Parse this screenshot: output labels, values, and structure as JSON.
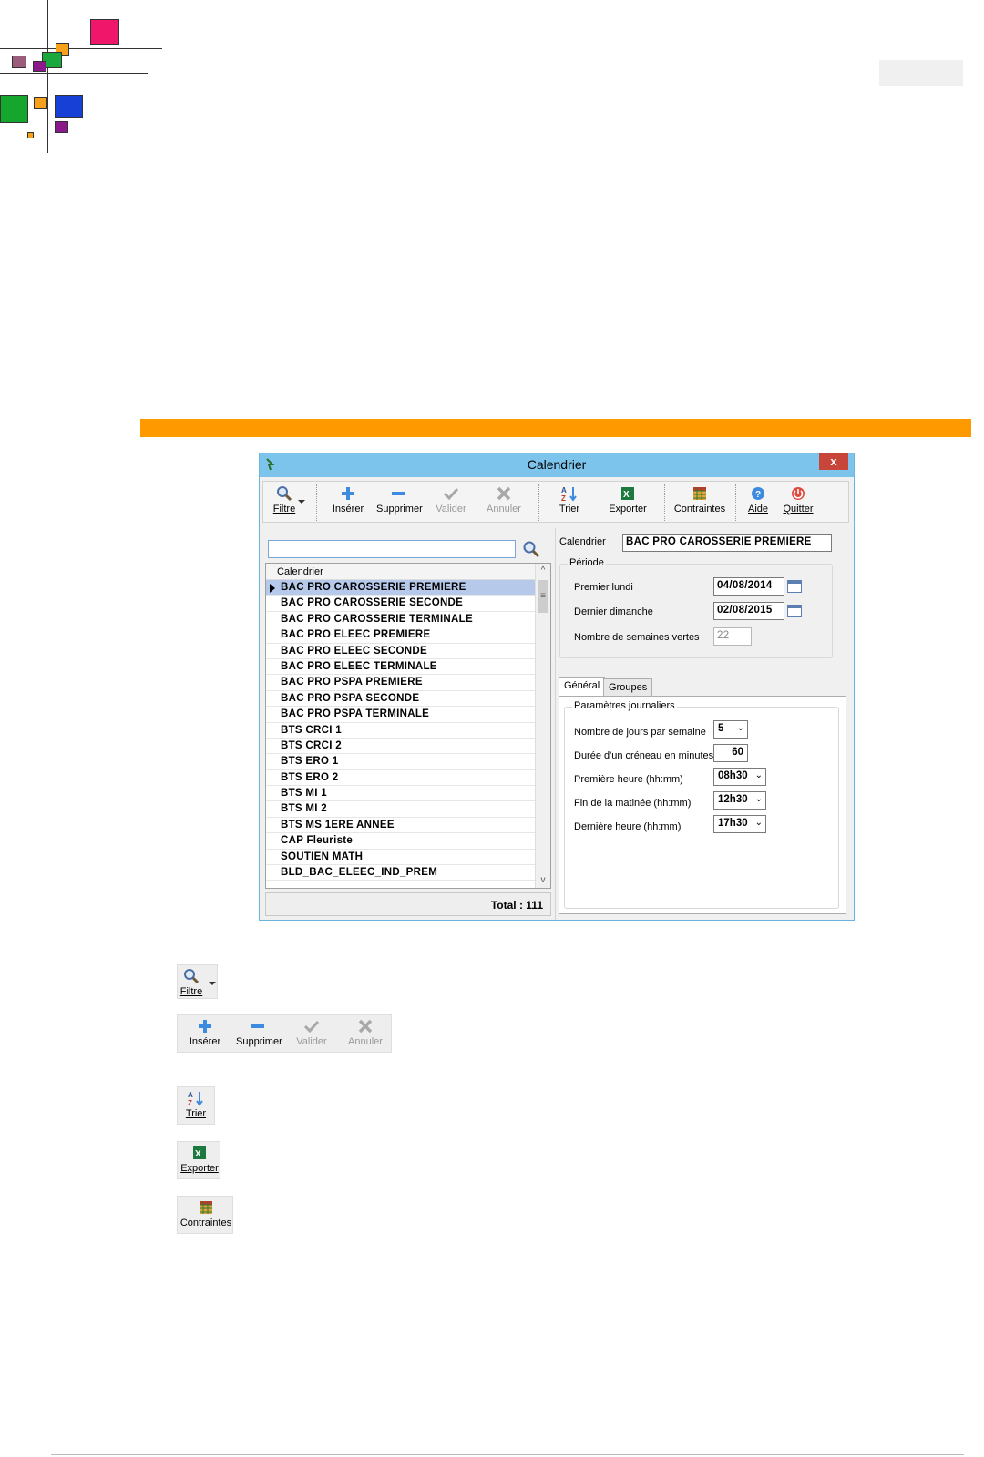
{
  "window": {
    "title": "Calendrier",
    "close_symbol": "x"
  },
  "toolbar": {
    "filtre": "Filtre",
    "inserer": "Insérer",
    "supprimer": "Supprimer",
    "valider": "Valider",
    "annuler": "Annuler",
    "trier": "Trier",
    "exporter": "Exporter",
    "contraintes": "Contraintes",
    "aide": "Aide",
    "quitter": "Quitter"
  },
  "list": {
    "search_value": "",
    "column_header": "Calendrier",
    "rows": [
      "BAC PRO CAROSSERIE PREMIERE",
      "BAC PRO CAROSSERIE SECONDE",
      "BAC PRO CAROSSERIE TERMINALE",
      "BAC PRO ELEEC PREMIERE",
      "BAC PRO ELEEC SECONDE",
      "BAC PRO ELEEC TERMINALE",
      "BAC PRO PSPA PREMIERE",
      "BAC PRO PSPA SECONDE",
      "BAC PRO PSPA TERMINALE",
      "BTS CRCI 1",
      "BTS CRCI 2",
      "BTS ERO 1",
      "BTS ERO 2",
      "BTS MI 1",
      "BTS MI 2",
      "BTS MS 1ERE ANNEE",
      "CAP Fleuriste",
      "SOUTIEN MATH",
      "BLD_BAC_ELEEC_IND_PREM"
    ],
    "total": "Total : 111",
    "scroll_up": "^",
    "scroll_down": "v",
    "thumb_glyph": "≡"
  },
  "detail": {
    "calendrier_label": "Calendrier",
    "calendrier_value": "BAC PRO CAROSSERIE PREMIERE",
    "periode_title": "Période",
    "premier_lundi_label": "Premier lundi",
    "premier_lundi_value": "04/08/2014",
    "dernier_dimanche_label": "Dernier dimanche",
    "dernier_dimanche_value": "02/08/2015",
    "semaines_label": "Nombre de semaines vertes",
    "semaines_value": "22",
    "tab_general": "Général",
    "tab_groupes": "Groupes",
    "params_title": "Paramètres journaliers",
    "jours_label": "Nombre de jours par semaine",
    "jours_value": "5",
    "duree_label": "Durée d'un créneau en minutes",
    "duree_value": "60",
    "premiere_heure_label": "Première heure (hh:mm)",
    "premiere_heure_value": "08h30",
    "fin_matinee_label": "Fin de la matinée (hh:mm)",
    "fin_matinee_value": "12h30",
    "derniere_heure_label": "Dernière heure (hh:mm)",
    "derniere_heure_value": "17h30"
  },
  "legend": {
    "filtre": "Filtre",
    "inserer": "Insérer",
    "supprimer": "Supprimer",
    "valider": "Valider",
    "annuler": "Annuler",
    "trier": "Trier",
    "exporter": "Exporter",
    "contraintes": "Contraintes"
  },
  "colors": {
    "accent_bar": "#ff9900",
    "titlebar": "#7cc4ec",
    "selected_row": "#b7c9ea"
  },
  "icons": [
    "search-icon",
    "plus-icon",
    "minus-icon",
    "check-icon",
    "cross-icon",
    "sort-az-icon",
    "excel-icon",
    "grid-icon",
    "help-icon",
    "power-icon",
    "calendar-icon",
    "chevron-down-icon"
  ]
}
